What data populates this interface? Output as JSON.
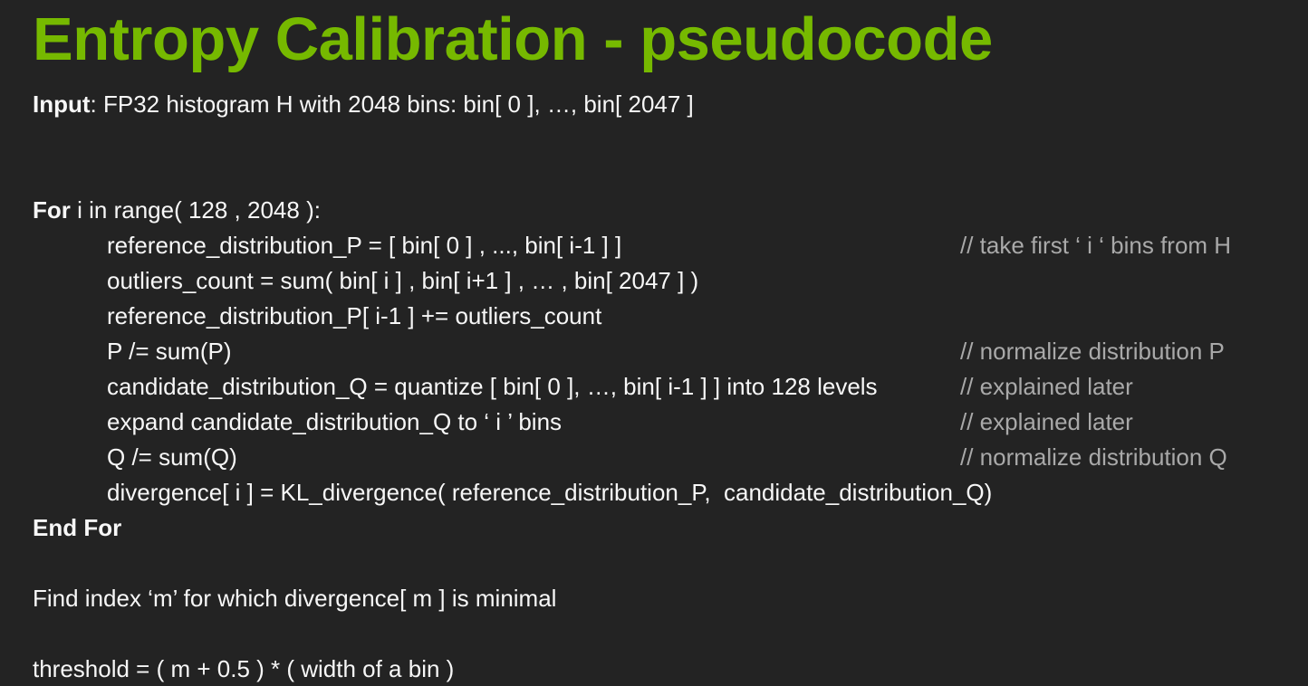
{
  "slide": {
    "title": "Entropy Calibration - pseudocode",
    "background_color": "#232323",
    "title_color": "#76b900",
    "text_color": "#f7f7f7",
    "comment_color": "#a9a9a9"
  },
  "pseudocode": {
    "input_label": "Input",
    "input_rest": ": FP32 histogram H with 2048 bins: bin[ 0 ], …, bin[ 2047 ]",
    "for_keyword": "For",
    "for_rest": " i in range( 128 , 2048 ):",
    "body": [
      {
        "code": "reference_distribution_P = [ bin[ 0 ] , ..., bin[ i-1 ] ]",
        "comment": "// take first ‘ i ‘ bins from H"
      },
      {
        "code": "outliers_count = sum( bin[ i ] , bin[ i+1 ] , … , bin[ 2047 ] )",
        "comment": ""
      },
      {
        "code": "reference_distribution_P[ i-1 ] += outliers_count",
        "comment": ""
      },
      {
        "code": "P /= sum(P)",
        "comment": "// normalize distribution P"
      },
      {
        "code": "candidate_distribution_Q = quantize [ bin[ 0 ], …, bin[ i-1 ] ] into 128 levels",
        "comment": "// explained later"
      },
      {
        "code": "expand candidate_distribution_Q to ‘ i ’ bins",
        "comment": "// explained later"
      },
      {
        "code": "Q /= sum(Q)",
        "comment": "// normalize distribution Q"
      },
      {
        "code": "divergence[ i ] = KL_divergence( reference_distribution_P,  candidate_distribution_Q)",
        "comment": ""
      }
    ],
    "end_for": "End For",
    "find_index_line": "Find index ‘m’ for which divergence[ m ] is minimal",
    "threshold_line": "threshold = ( m + 0.5 ) * ( width of a bin )"
  }
}
